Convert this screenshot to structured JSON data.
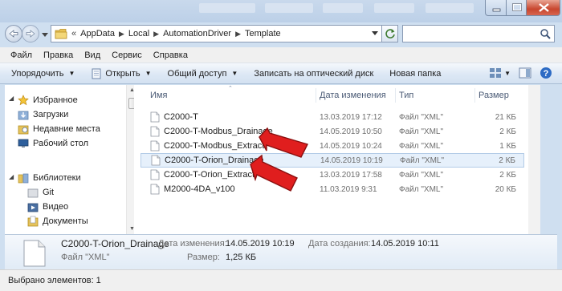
{
  "address": {
    "crumbs": [
      "AppData",
      "Local",
      "AutomationDriver",
      "Template"
    ],
    "lead": "«"
  },
  "menu": {
    "items": [
      {
        "label": "Файл",
        "u": "Ф"
      },
      {
        "label": "Правка",
        "u": "П"
      },
      {
        "label": "Вид",
        "u": "В"
      },
      {
        "label": "Сервис",
        "u": "С"
      },
      {
        "label": "Справка",
        "u": "С"
      }
    ]
  },
  "toolbar": {
    "organize": "Упорядочить",
    "open": "Открыть",
    "share": "Общий доступ",
    "burn": "Записать на оптический диск",
    "new_folder": "Новая папка"
  },
  "nav": {
    "favorites": "Избранное",
    "downloads": "Загрузки",
    "recent": "Недавние места",
    "desktop": "Рабочий стол",
    "libraries": "Библиотеки",
    "git": "Git",
    "video": "Видео",
    "documents": "Документы"
  },
  "columns": {
    "name": "Имя",
    "date": "Дата изменения",
    "type": "Тип",
    "size": "Размер"
  },
  "files": [
    {
      "name": "C2000-T",
      "date": "13.03.2019 17:12",
      "type": "Файл \"XML\"",
      "size": "21 КБ"
    },
    {
      "name": "C2000-T-Modbus_Drainage",
      "date": "14.05.2019 10:50",
      "type": "Файл \"XML\"",
      "size": "2 КБ"
    },
    {
      "name": "C2000-T-Modbus_Extract",
      "date": "14.05.2019 10:24",
      "type": "Файл \"XML\"",
      "size": "1 КБ"
    },
    {
      "name": "C2000-T-Orion_Drainage",
      "date": "14.05.2019 10:19",
      "type": "Файл \"XML\"",
      "size": "2 КБ"
    },
    {
      "name": "C2000-T-Orion_Extract",
      "date": "13.03.2019 17:58",
      "type": "Файл \"XML\"",
      "size": "2 КБ"
    },
    {
      "name": "M2000-4DA_v100",
      "date": "11.03.2019 9:31",
      "type": "Файл \"XML\"",
      "size": "20 КБ"
    }
  ],
  "selected_index": 3,
  "details": {
    "name": "C2000-T-Orion_Drainage",
    "type": "Файл \"XML\"",
    "modified_label": "Дата изменения:",
    "modified_value": "14.05.2019 10:19",
    "created_label": "Дата создания:",
    "created_value": "14.05.2019 10:11",
    "size_label": "Размер:",
    "size_value": "1,25 КБ"
  },
  "status": {
    "text": "Выбрано элементов: 1"
  },
  "colors": {
    "selection": "#e6f0fb",
    "annotation_arrow": "#e01e1e"
  }
}
